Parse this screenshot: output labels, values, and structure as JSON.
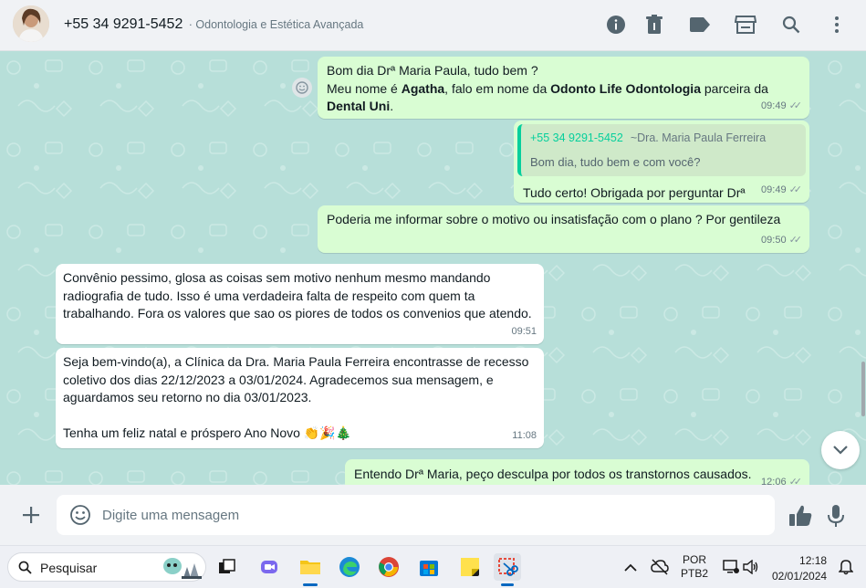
{
  "header": {
    "contact_number": "+55 34 9291-5452",
    "contact_subtitle": "· Odontologia e Estética Avançada",
    "icons": [
      "info-icon",
      "trash-icon",
      "label-icon",
      "store-icon",
      "search-icon",
      "more-vertical-icon"
    ]
  },
  "messages": [
    {
      "dir": "out",
      "line1": "Bom dia Drª Maria Paula, tudo bem ?",
      "line2_pre": "Meu nome é ",
      "line2_bold1": "Agatha",
      "line2_mid": ", falo em nome da ",
      "line2_bold2": "Odonto Life Odontologia",
      "line2_post": " parceira da",
      "line3_bold": "Dental Uni",
      "line3_post": ".",
      "time": "09:49"
    },
    {
      "dir": "out",
      "quote_author": "+55 34 9291-5452",
      "quote_alias": "~Dra. Maria Paula Ferreira",
      "quote_text": "Bom dia, tudo bem e com você?",
      "text": "Tudo certo! Obrigada por perguntar Drª",
      "time": "09:49"
    },
    {
      "dir": "out",
      "text": "Poderia me informar sobre o motivo ou insatisfação com o plano ? Por gentileza",
      "time": "09:50"
    },
    {
      "dir": "in",
      "text": "Convênio pessimo, glosa as coisas sem motivo nenhum mesmo mandando\nradiografia de tudo. Isso é uma verdadeira falta de respeito com quem ta\ntrabalhando. Fora os valores que sao os piores de todos os convenios que atendo.",
      "time": "09:51"
    },
    {
      "dir": "in",
      "text": "Seja bem-vindo(a), a Clínica da Dra. Maria Paula Ferreira encontrasse de recesso\ncoletivo dos dias 22/12/2023 a 03/01/2024. Agradecemos sua mensagem, e\naguardamos seu retorno no dia 03/01/2023.\n\nTenha um feliz natal e próspero Ano Novo",
      "emojis": "👏🎉🎄",
      "time": "11:08"
    },
    {
      "dir": "out",
      "text": "Entendo Drª Maria, peço desculpa por todos os transtornos causados.",
      "time": "12:06"
    }
  ],
  "composer": {
    "placeholder": "Digite uma mensagem"
  },
  "taskbar": {
    "search_label": "Pesquisar",
    "language_line1": "POR",
    "language_line2": "PTB2",
    "clock_time": "12:18",
    "clock_date": "02/01/2024",
    "apps": [
      "task-view-icon",
      "teams-icon",
      "file-explorer-icon",
      "edge-icon",
      "chrome-icon",
      "store-icon",
      "sticky-notes-icon",
      "snipping-tool-icon"
    ]
  },
  "colors": {
    "chat_bg": "#b7dfd9",
    "outgoing_bubble": "#d9fdd3",
    "incoming_bubble": "#ffffff",
    "accent": "#06cf9c"
  }
}
